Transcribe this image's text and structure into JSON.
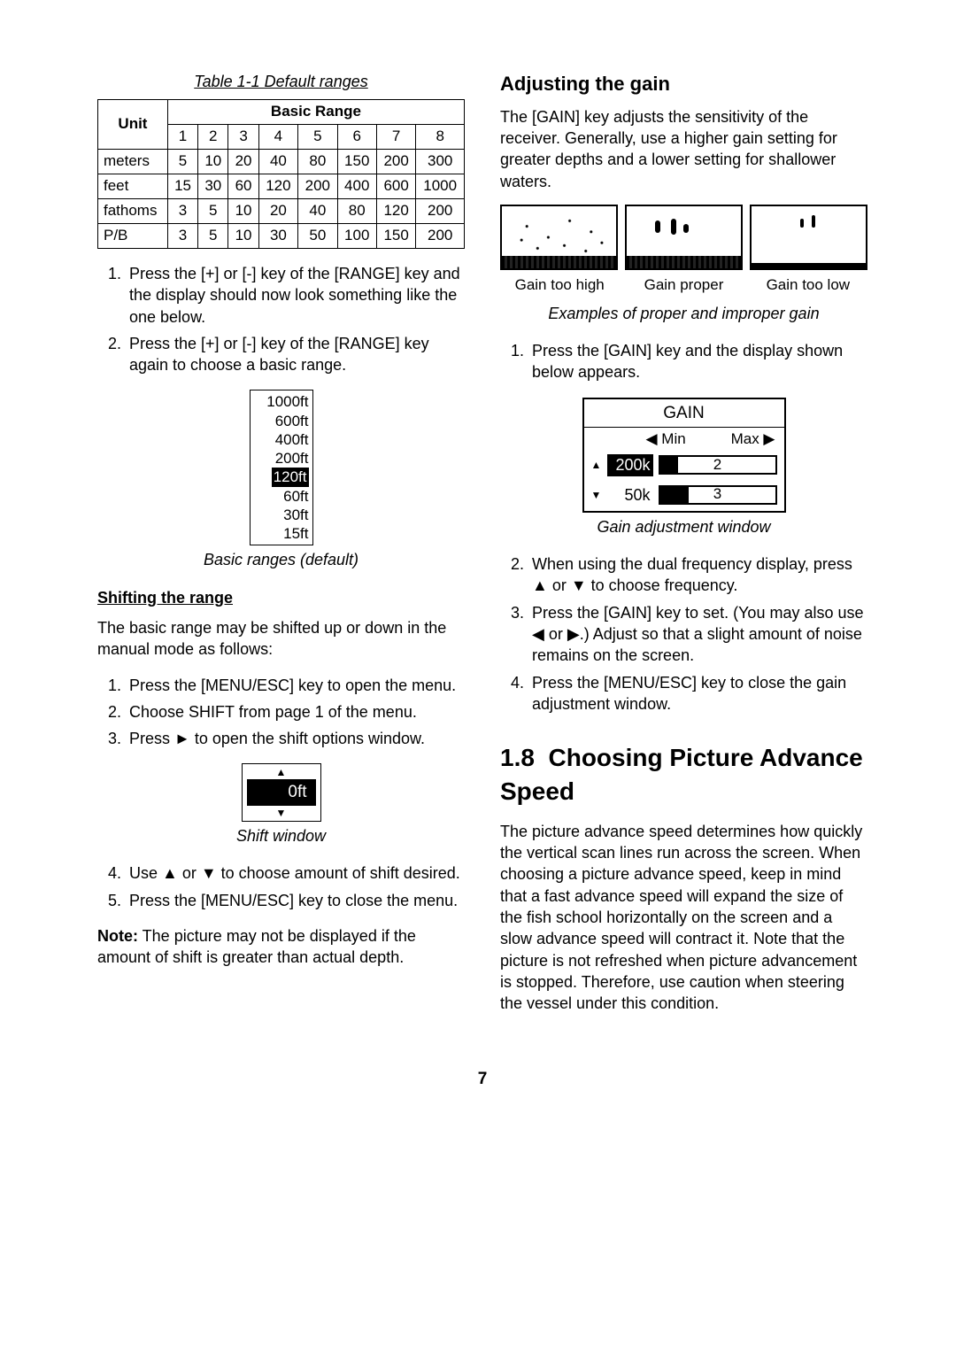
{
  "left": {
    "table_caption": "Table 1-1 Default ranges",
    "table": {
      "unit_header": "Unit",
      "basic_header": "Basic Range",
      "cols": [
        "1",
        "2",
        "3",
        "4",
        "5",
        "6",
        "7",
        "8"
      ],
      "rows": [
        {
          "unit": "meters",
          "v": [
            "5",
            "10",
            "20",
            "40",
            "80",
            "150",
            "200",
            "300"
          ]
        },
        {
          "unit": "feet",
          "v": [
            "15",
            "30",
            "60",
            "120",
            "200",
            "400",
            "600",
            "1000"
          ]
        },
        {
          "unit": "fathoms",
          "v": [
            "3",
            "5",
            "10",
            "20",
            "40",
            "80",
            "120",
            "200"
          ]
        },
        {
          "unit": "P/B",
          "v": [
            "3",
            "5",
            "10",
            "30",
            "50",
            "100",
            "150",
            "200"
          ]
        }
      ]
    },
    "steps_a": [
      "Press the [+] or [-] key of the [RANGE] key and the display should now look something like the one below.",
      "Press the [+] or [-] key of the [RANGE] key again to choose a basic range."
    ],
    "range_list": [
      "1000ft",
      "600ft",
      "400ft",
      "200ft",
      "120ft",
      "60ft",
      "30ft",
      "15ft"
    ],
    "range_list_selected": "120ft",
    "range_caption": "Basic ranges (default)",
    "shift_heading": "Shifting the range",
    "shift_intro": "The basic range may be shifted up or down in the manual mode as follows:",
    "steps_b": [
      "Press the [MENU/ESC] key to open the menu.",
      "Choose SHIFT from page 1 of the menu.",
      "Press ► to open the shift options window."
    ],
    "shift_value": "0ft",
    "shift_caption": "Shift window",
    "steps_c": [
      "Use ▲ or ▼ to choose amount of shift desired.",
      "Press the [MENU/ESC] key to close the menu."
    ],
    "note_label": "Note:",
    "note_text": " The picture may not be displayed if the amount of shift is greater than actual depth."
  },
  "right": {
    "gain_heading": "Adjusting the gain",
    "gain_intro": "The [GAIN] key adjusts the sensitivity of the receiver. Generally, use a higher gain setting for greater depths and a lower setting for shallower waters.",
    "gain_labels": [
      "Gain too high",
      "Gain proper",
      "Gain too low"
    ],
    "gain_example_caption": "Examples of proper and improper gain",
    "steps_a": [
      "Press the [GAIN] key and the display shown below appears."
    ],
    "gain_window": {
      "title": "GAIN",
      "min": "◀ Min",
      "max": "Max ▶",
      "rows": [
        {
          "tri": "▲",
          "freq": "200k",
          "sel": true,
          "val": "2",
          "bar_pct": 16
        },
        {
          "tri": "▼",
          "freq": "50k",
          "sel": false,
          "val": "3",
          "bar_pct": 25
        }
      ]
    },
    "gain_window_caption": "Gain adjustment window",
    "steps_b": [
      "When using the dual frequency display, press ▲ or ▼ to choose frequency.",
      "Press the [GAIN] key to set. (You may also use ◀ or ▶.) Adjust so that a slight amount of noise remains on the screen.",
      "Press the [MENU/ESC] key to close the gain adjustment window."
    ],
    "section_heading_num": "1.8",
    "section_heading": "Choosing Picture Advance Speed",
    "section_text": "The picture advance speed determines how quickly the vertical scan lines run across the screen. When choosing a picture advance speed, keep in mind that a fast advance speed will expand the size of the fish school horizontally on the screen and a slow advance speed will contract it. Note that the picture is not refreshed when picture advancement is stopped. Therefore, use caution when steering the vessel under this condition."
  },
  "page_number": "7"
}
